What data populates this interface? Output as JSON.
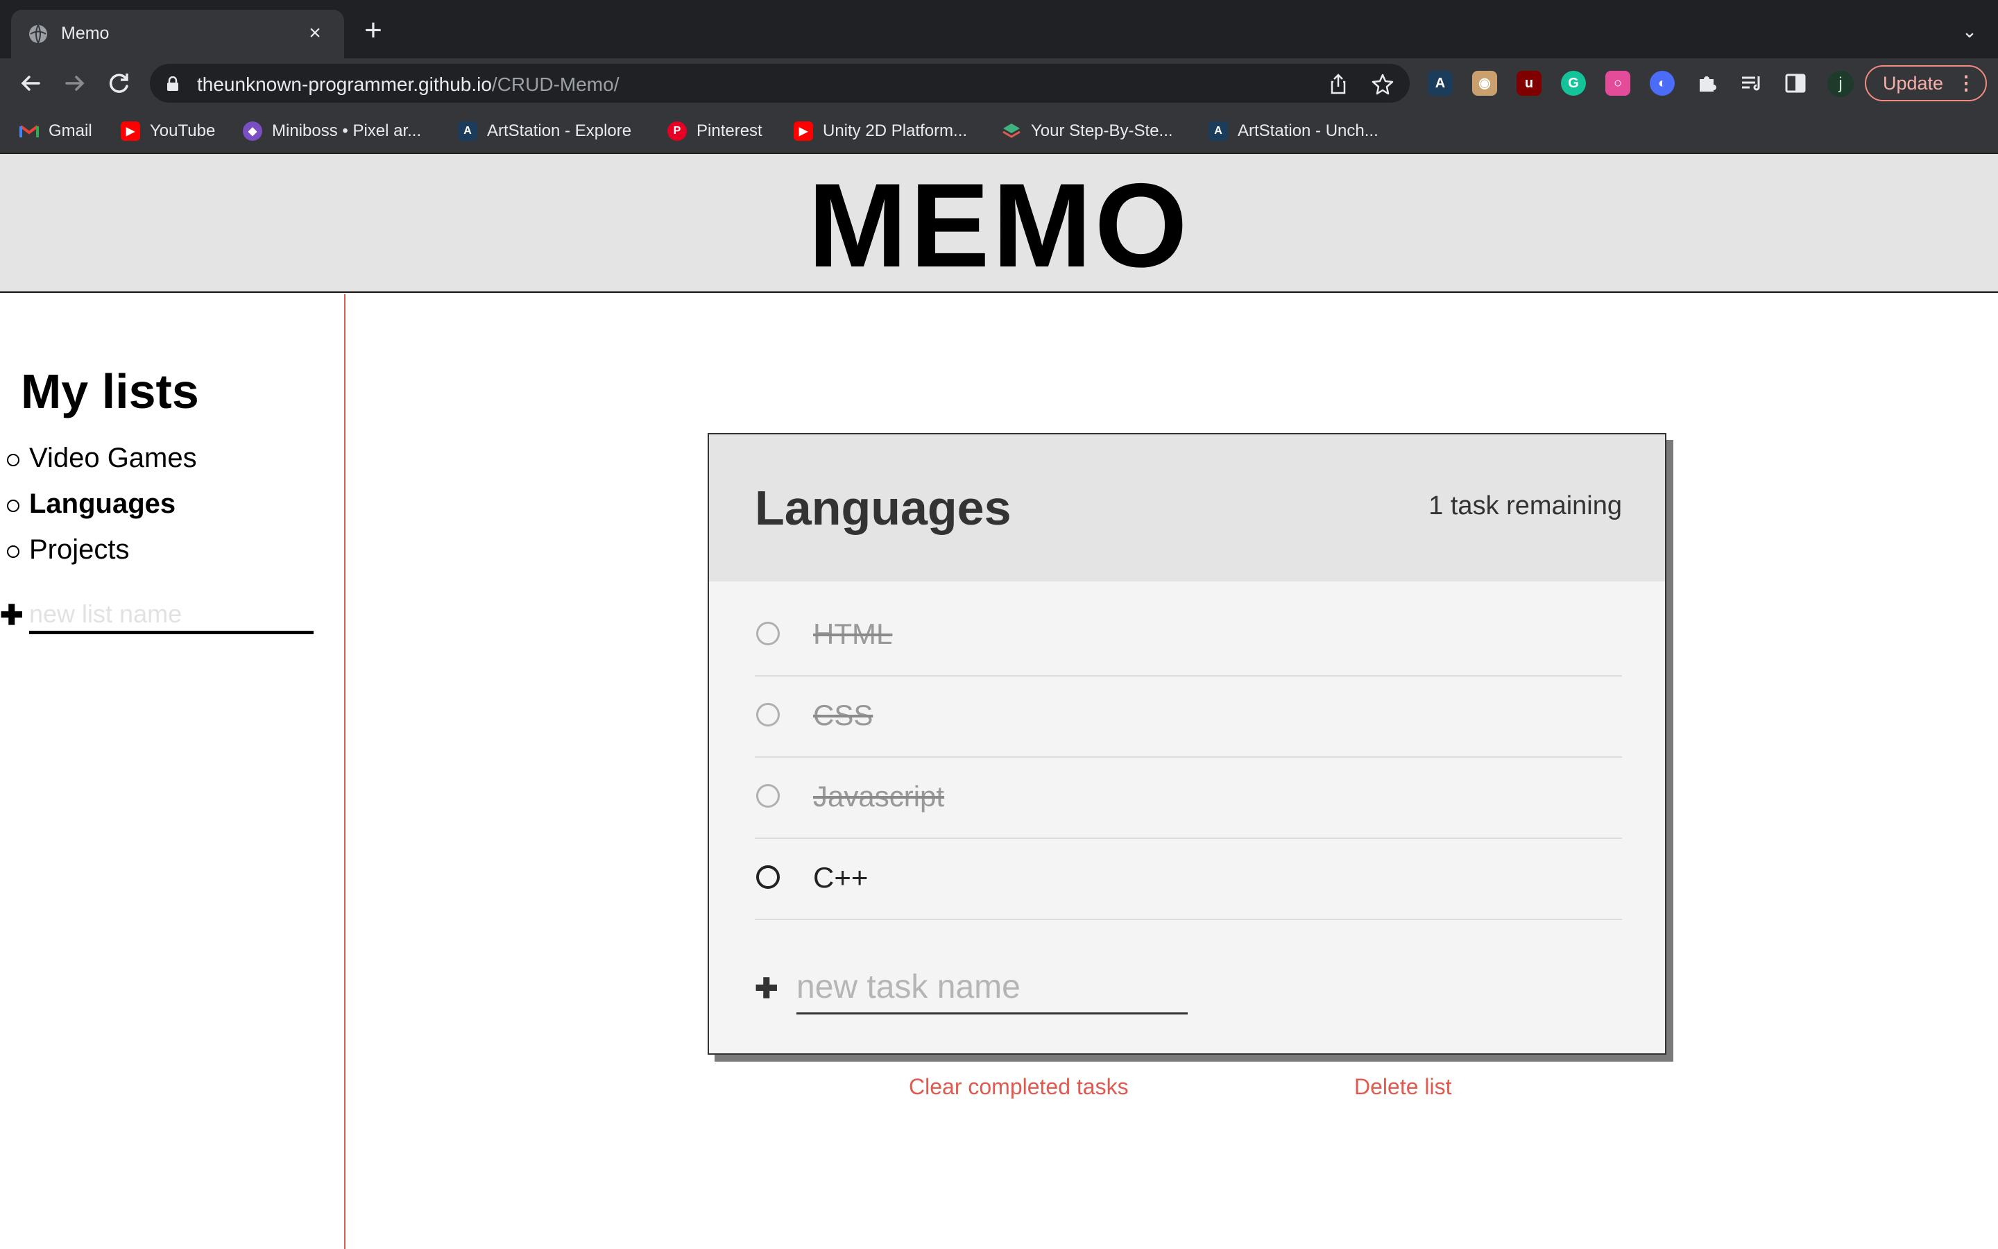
{
  "browser": {
    "tab_title": "Memo",
    "tab_close_icon": "×",
    "new_tab_icon": "+",
    "tab_menu_icon": "⌄",
    "url_host": "theunknown-programmer.github.io",
    "url_path": "/CRUD-Memo/",
    "update_label": "Update",
    "update_menu_icon": "⋮",
    "profile_initial": "j",
    "bookmarks": [
      {
        "label": "Gmail",
        "icon": "gmail-icon",
        "color": "#ea4335"
      },
      {
        "label": "YouTube",
        "icon": "youtube-icon",
        "color": "#ff0000"
      },
      {
        "label": "Miniboss • Pixel ar...",
        "icon": "miniboss-icon",
        "color": "#7b4fc4"
      },
      {
        "label": "ArtStation - Explore",
        "icon": "artstation-icon",
        "color": "#13aff0"
      },
      {
        "label": "Pinterest",
        "icon": "pinterest-icon",
        "color": "#e60023"
      },
      {
        "label": "Unity 2D Platform...",
        "icon": "youtube-icon",
        "color": "#ff0000"
      },
      {
        "label": "Your Step-By-Ste...",
        "icon": "layers-icon",
        "color": "#3fb37f"
      },
      {
        "label": "ArtStation - Unch...",
        "icon": "artstation-icon",
        "color": "#13aff0"
      }
    ],
    "extensions": [
      {
        "name": "artstation-ext-icon",
        "color": "#1b3c5a"
      },
      {
        "name": "owl-ext-icon",
        "color": "#caa06e"
      },
      {
        "name": "ublock-ext-icon",
        "color": "#800000"
      },
      {
        "name": "grammarly-ext-icon",
        "color": "#15c39a"
      },
      {
        "name": "color-ext-icon",
        "color": "#e44c9a"
      },
      {
        "name": "shield-ext-icon",
        "color": "#4a6cf7"
      }
    ]
  },
  "app": {
    "title": "MEMO",
    "sidebar_title": "My lists",
    "lists": [
      {
        "label": "Video Games",
        "active": false
      },
      {
        "label": "Languages",
        "active": true
      },
      {
        "label": "Projects",
        "active": false
      }
    ],
    "new_list_placeholder": "new list name",
    "active_list": {
      "title": "Languages",
      "remaining": "1 task remaining",
      "tasks": [
        {
          "label": "HTML",
          "done": true
        },
        {
          "label": "CSS",
          "done": true
        },
        {
          "label": "Javascript",
          "done": true
        },
        {
          "label": "C++",
          "done": false
        }
      ],
      "new_task_placeholder": "new task name"
    },
    "clear_completed_label": "Clear completed tasks",
    "delete_list_label": "Delete list",
    "colors": {
      "accent": "#e05a4f",
      "banner_bg": "#e4e4e4",
      "card_bg": "#f4f4f4"
    }
  }
}
